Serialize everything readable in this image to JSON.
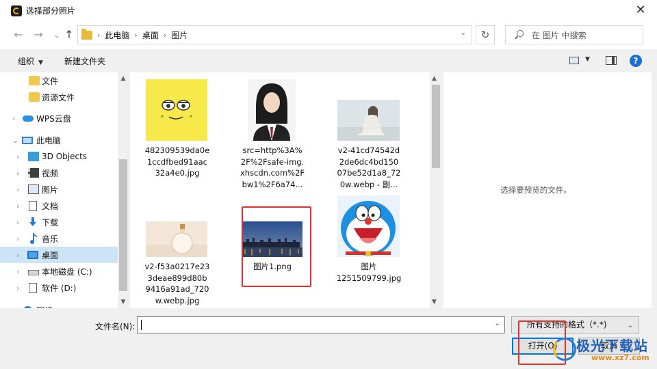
{
  "window": {
    "title": "选择部分照片",
    "close": "✕"
  },
  "nav": {
    "back": "←",
    "forward": "→",
    "recent": "⌄",
    "up": "↑",
    "breadcrumb": [
      "此电脑",
      "桌面",
      "图片"
    ],
    "search_placeholder": "在 图片 中搜索"
  },
  "toolbar": {
    "organize": "组织",
    "new_folder": "新建文件夹",
    "help": "?"
  },
  "sidebar": {
    "items": [
      {
        "label": "文件",
        "icon": "folder-icon"
      },
      {
        "label": "资源文件",
        "icon": "folder-icon"
      },
      {
        "label": "WPS云盘",
        "icon": "cloud-icon"
      },
      {
        "label": "此电脑",
        "icon": "computer-icon"
      },
      {
        "label": "3D Objects",
        "icon": "3d-objects-icon"
      },
      {
        "label": "视频",
        "icon": "video-icon"
      },
      {
        "label": "图片",
        "icon": "pictures-icon"
      },
      {
        "label": "文档",
        "icon": "document-icon"
      },
      {
        "label": "下载",
        "icon": "download-icon"
      },
      {
        "label": "音乐",
        "icon": "music-icon"
      },
      {
        "label": "桌面",
        "icon": "desktop-icon",
        "selected": true
      },
      {
        "label": "本地磁盘 (C:)",
        "icon": "drive-icon"
      },
      {
        "label": "软件 (D:)",
        "icon": "drive-icon"
      },
      {
        "label": "网络",
        "icon": "network-icon"
      }
    ]
  },
  "files": [
    {
      "name": "482309539da0e1ccdfbed91aac32a4e0.jpg",
      "line1": "482309539da0e",
      "line2": "1ccdfbed91aac",
      "line3": "32a4e0.jpg"
    },
    {
      "name": "src=http...",
      "line1": "src=http%3A%",
      "line2": "2F%2Fsafe-img.",
      "line3": "xhscdn.com%2F",
      "line4": "bw1%2F6a74..."
    },
    {
      "name": "v2-41cd74542d...",
      "line1": "v2-41cd74542d",
      "line2": "2de6dc4bd150",
      "line3": "07be52d1a8_72",
      "line4": "0w.webp - 副..."
    },
    {
      "name": "v2-f53a0217e23...",
      "line1": "v2-f53a0217e23",
      "line2": "3deae899d80b",
      "line3": "9416a91ad_720",
      "line4": "w.webp.jpg"
    },
    {
      "name": "图片1.png",
      "line1": "图片1.png"
    },
    {
      "name": "图片1251509799.jpg",
      "line1": "图片",
      "line2": "1251509799.jpg"
    }
  ],
  "preview": {
    "message": "选择要预览的文件。"
  },
  "bottom": {
    "filename_label": "文件名(N):",
    "filename_value": "",
    "filetype": "所有支持的格式（*.*)",
    "open": "打开(O)",
    "cancel": "取消"
  },
  "watermark": {
    "text": "极光下载站",
    "url": "www.xz7.com"
  }
}
